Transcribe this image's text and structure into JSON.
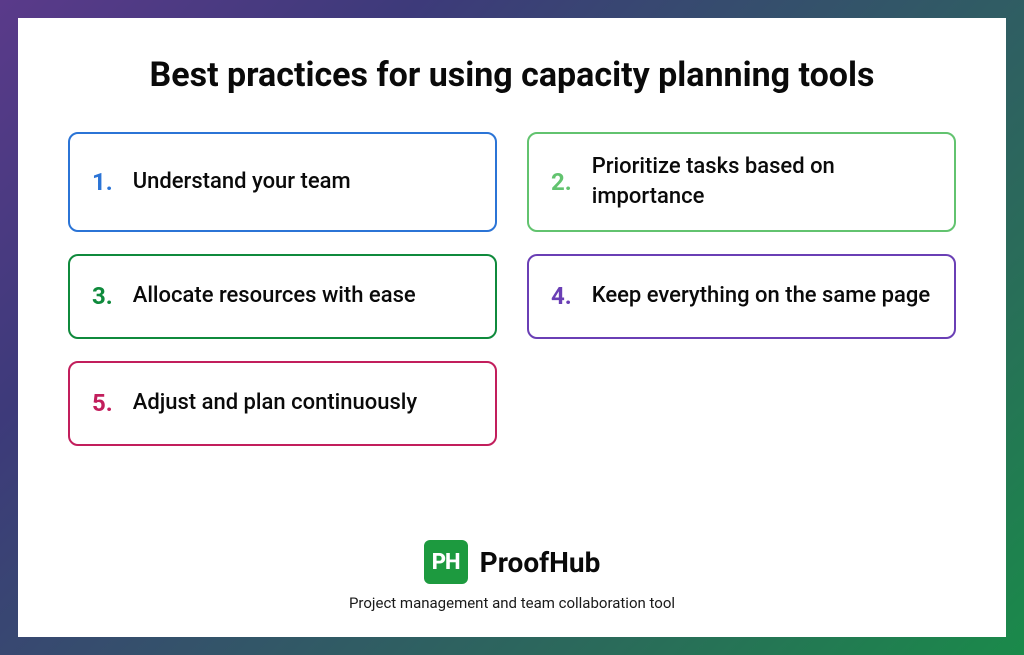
{
  "title": "Best practices for using capacity planning tools",
  "items": [
    {
      "num": "1.",
      "text": "Understand your team",
      "color": "#2b74d6"
    },
    {
      "num": "2.",
      "text": "Prioritize tasks based on importance",
      "color": "#62c36f"
    },
    {
      "num": "3.",
      "text": "Allocate resources with ease",
      "color": "#0f8a3c"
    },
    {
      "num": "4.",
      "text": "Keep everything on the same page",
      "color": "#6a3fb5"
    },
    {
      "num": "5.",
      "text": "Adjust and plan continuously",
      "color": "#c21e5c"
    }
  ],
  "brand": {
    "logo_text": "PH",
    "name": "ProofHub",
    "tagline": "Project management and team collaboration tool"
  }
}
